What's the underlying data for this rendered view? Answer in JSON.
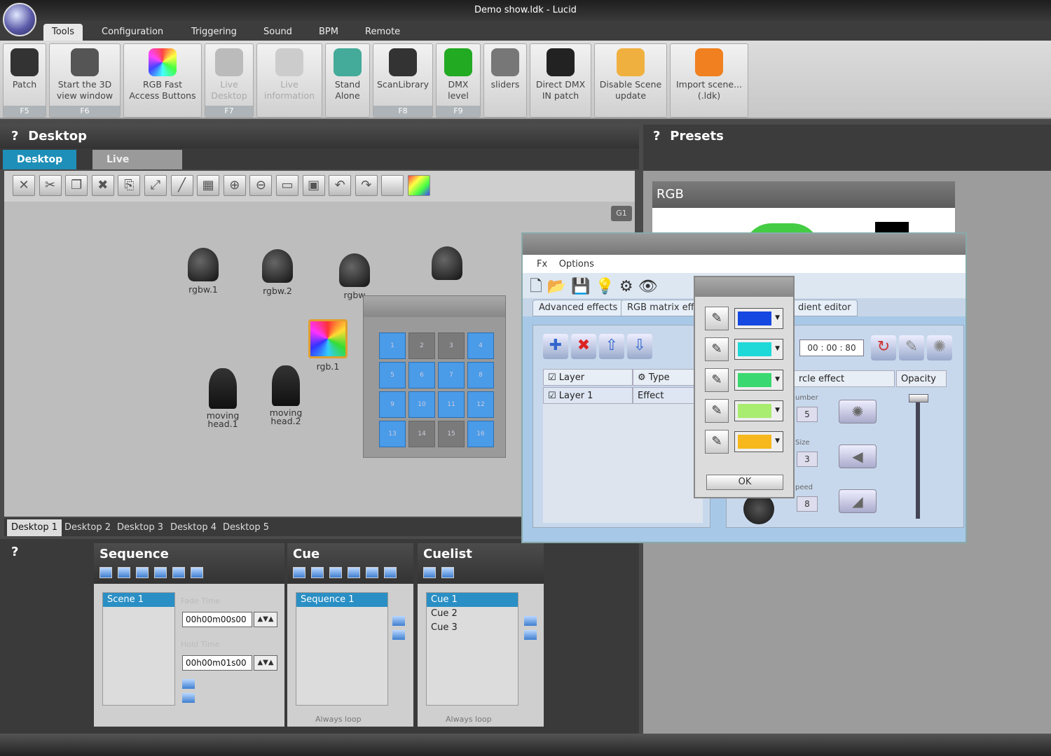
{
  "window": {
    "title": "Demo show.ldk - Lucid"
  },
  "menu": {
    "tabs": [
      "Tools",
      "Configuration",
      "Triggering",
      "Sound",
      "BPM",
      "Remote"
    ]
  },
  "ribbon": {
    "buttons": [
      {
        "label1": "Patch",
        "label2": "",
        "key": "F5",
        "icon": "patch-icon",
        "disabled": false
      },
      {
        "label1": "Start the 3D",
        "label2": "view window",
        "key": "F6",
        "icon": "3d-view-icon",
        "disabled": false
      },
      {
        "label1": "RGB Fast",
        "label2": "Access Buttons",
        "key": "",
        "icon": "rgb-wheel-icon",
        "disabled": false
      },
      {
        "label1": "Live",
        "label2": "Desktop",
        "key": "F7",
        "icon": "live-desktop-icon",
        "disabled": true
      },
      {
        "label1": "Live",
        "label2": "information",
        "key": "",
        "icon": "question-icon",
        "disabled": true
      },
      {
        "label1": "Stand",
        "label2": "Alone",
        "key": "",
        "icon": "stand-alone-icon",
        "disabled": false
      },
      {
        "label1": "ScanLibrary",
        "label2": "",
        "key": "F8",
        "icon": "scan-library-icon",
        "disabled": false
      },
      {
        "label1": "DMX",
        "label2": "level",
        "key": "F9",
        "icon": "dmx-level-icon",
        "disabled": false
      },
      {
        "label1": "sliders",
        "label2": "",
        "key": "",
        "icon": "sliders-icon",
        "disabled": false
      },
      {
        "label1": "Direct DMX",
        "label2": "IN patch",
        "key": "",
        "icon": "dmx-in-icon",
        "disabled": false
      },
      {
        "label1": "Disable Scene",
        "label2": "update",
        "key": "",
        "icon": "lock-icon",
        "disabled": false
      },
      {
        "label1": "Import scene...",
        "label2": "(.ldk)",
        "key": "",
        "icon": "import-icon",
        "disabled": false
      }
    ]
  },
  "desktop": {
    "title": "Desktop",
    "tabs": [
      "Desktop",
      "Live"
    ],
    "group_label": "G1",
    "fixtures": [
      {
        "name": "rgbw.1"
      },
      {
        "name": "rgbw.2"
      },
      {
        "name": "rgbw"
      },
      {
        "name": ""
      },
      {
        "name": "rgb.1"
      },
      {
        "name": "moving head.1"
      },
      {
        "name": "moving head.2"
      }
    ],
    "matrix_cells": [
      "1",
      "2",
      "3",
      "4",
      "5",
      "6",
      "7",
      "8",
      "9",
      "10",
      "11",
      "12",
      "13",
      "14",
      "15",
      "16"
    ],
    "bottom_tabs": [
      "Desktop 1",
      "Desktop 2",
      "Desktop 3",
      "Desktop 4",
      "Desktop 5"
    ]
  },
  "presets": {
    "title": "Presets",
    "rgb_label": "RGB"
  },
  "sequence": {
    "title": "Sequence",
    "items": [
      "Scene 1"
    ],
    "fade_label": "Fade Time",
    "fade_value": "00h00m00s00",
    "hold_label": "Hold Time",
    "hold_value": "00h00m01s00"
  },
  "cue": {
    "title": "Cue",
    "items": [
      "Sequence 1"
    ],
    "loop": "Always loop"
  },
  "cuelist": {
    "title": "Cuelist",
    "items": [
      "Cue 1",
      "Cue 2",
      "Cue 3"
    ],
    "loop": "Always loop"
  },
  "fx": {
    "menu": [
      "Fx",
      "Options"
    ],
    "tabs": [
      "Advanced effects",
      "RGB matrix effe",
      "dient editor"
    ],
    "col_layer": "Layer",
    "col_type": "Type",
    "row_layer": "Layer 1",
    "row_type": "Effect",
    "time": "00 : 00 : 80",
    "circle_effect": "rcle effect",
    "opacity": "Opacity",
    "number_label": "umber",
    "number_value": "5",
    "size_label": "Size",
    "size_value": "3",
    "speed_label": "peed",
    "speed_value": "8"
  },
  "picker": {
    "colors": [
      "#1448e0",
      "#1fd8d8",
      "#3ad870",
      "#a8ec70",
      "#f6b81c"
    ],
    "ok": "OK"
  }
}
